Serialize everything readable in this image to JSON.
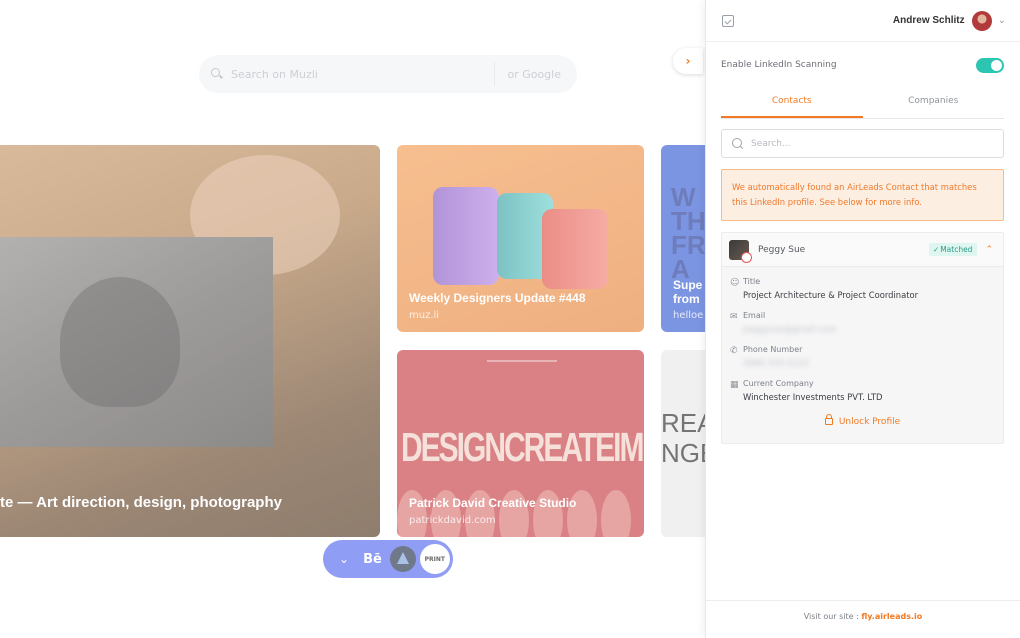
{
  "background": {
    "search": {
      "placeholder": "Search on Muzli",
      "google_label": "or Google"
    },
    "cards": [
      {
        "title": "te — Art direction, design, photography"
      },
      {
        "title": "Weekly Designers Update #448",
        "source": "muz.li"
      },
      {
        "title": "Supe",
        "title_line2": "from",
        "source": "helloe",
        "headline": "W\nTH\nFR\nA"
      },
      {
        "headline": "DESIGNCREATEIMPRESS",
        "title": "Patrick David Creative Studio",
        "source": "patrickdavid.com"
      },
      {
        "headline": "REA\nNGE"
      }
    ],
    "dock": {
      "behance_label": "Bē",
      "print_label": "PRINT"
    }
  },
  "panel": {
    "user_name": "Andrew Schlitz",
    "scanning_label": "Enable LinkedIn Scanning",
    "scanning_enabled": true,
    "tabs": [
      {
        "label": "Contacts",
        "active": true
      },
      {
        "label": "Companies",
        "active": false
      }
    ],
    "search_placeholder": "Search...",
    "notice": "We automatically found an AirLeads Contact that matches this LinkedIn profile. See below for more info.",
    "contact": {
      "name": "Peggy Sue",
      "badge": "Matched",
      "fields": [
        {
          "label": "Title",
          "value": "Project Architecture & Project Coordinator",
          "icon": "person-icon",
          "blurred": false
        },
        {
          "label": "Email",
          "value": "peggysue@gmail.com",
          "icon": "mail-icon",
          "blurred": true
        },
        {
          "label": "Phone Number",
          "value": "(888) 555-0123",
          "icon": "phone-icon",
          "blurred": true
        },
        {
          "label": "Current Company",
          "value": "Winchester Investments PVT. LTD",
          "icon": "building-icon",
          "blurred": false
        }
      ],
      "unlock_label": "Unlock Profile"
    },
    "footer": {
      "prefix": "Visit our site :",
      "link": "fly.airleads.io"
    },
    "colors": {
      "accent": "#f07a24",
      "toggle": "#2cc5b1",
      "matched": "#2a9e8c"
    }
  }
}
